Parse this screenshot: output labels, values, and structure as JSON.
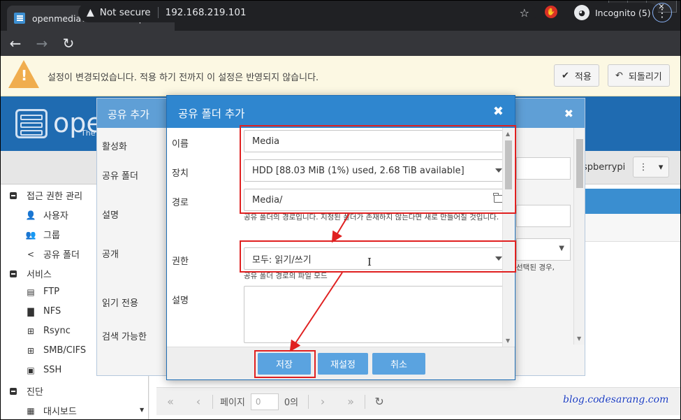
{
  "browser": {
    "tab_title": "openmediavault control panel - ",
    "tab_close": "✕",
    "new_tab": "+",
    "window_controls": [
      "—",
      "□",
      "✕"
    ],
    "omnibox": {
      "security_label": "Not secure",
      "url": "192.168.219.101"
    },
    "incognito_label": "Incognito (5)"
  },
  "notice": {
    "message": "설정이 변경되었습니다. 적용 하기 전까지 이 설정은 반영되지 않습니다.",
    "apply_label": "적용",
    "revert_label": "되돌리기"
  },
  "header": {
    "logo_text": "ope",
    "logo_sub": "The"
  },
  "sidebar": {
    "items": [
      {
        "label": "접근 권한 관리",
        "icon": "minus-square-icon"
      },
      {
        "label": "사용자",
        "icon": "user-icon"
      },
      {
        "label": "그룹",
        "icon": "group-icon"
      },
      {
        "label": "공유 폴더",
        "icon": "share-icon"
      },
      {
        "label": "서비스",
        "icon": "minus-square-icon"
      },
      {
        "label": "FTP",
        "icon": "server-icon"
      },
      {
        "label": "NFS",
        "icon": "desktop-icon"
      },
      {
        "label": "Rsync",
        "icon": "sitemap-icon"
      },
      {
        "label": "SMB/CIFS",
        "icon": "windows-icon"
      },
      {
        "label": "SSH",
        "icon": "terminal-icon"
      },
      {
        "label": "진단",
        "icon": "minus-square-icon"
      },
      {
        "label": "대시보드",
        "icon": "dashboard-icon"
      }
    ]
  },
  "right_panel": {
    "hostname": "spberrypi"
  },
  "pager": {
    "page_label": "페이지",
    "page_value": "0",
    "of_label": "0의"
  },
  "watermark": "blog.codesarang.com",
  "back_dialog": {
    "title": "공유 추가",
    "labels": [
      "활성화",
      "공유 폴더",
      "설명",
      "공개",
      "읽기 전용",
      "검색 가능한"
    ],
    "side_hint": "선택된 경우,"
  },
  "dialog": {
    "title": "공유 폴더 추가",
    "fields": {
      "name": {
        "label": "이름",
        "value": "Media"
      },
      "device": {
        "label": "장치",
        "value": "HDD [88.03 MiB (1%) used, 2.68 TiB available]"
      },
      "path": {
        "label": "경로",
        "value": "Media/"
      },
      "path_hint": "공유 폴더의 경로입니다. 지정된 폴더가 존재하지 않는다면 새로 만들어질 것입니다.",
      "permissions": {
        "label": "권한",
        "value": "모두: 읽기/쓰기"
      },
      "permissions_hint": "공유 폴더 경로의 파일 모드",
      "description": {
        "label": "설명",
        "value": ""
      }
    },
    "buttons": {
      "save": "저장",
      "reset": "재설정",
      "cancel": "취소"
    }
  },
  "colors": {
    "highlight": "#e02020",
    "dialog_header": "#2f86cf",
    "button": "#5aa3e0"
  }
}
